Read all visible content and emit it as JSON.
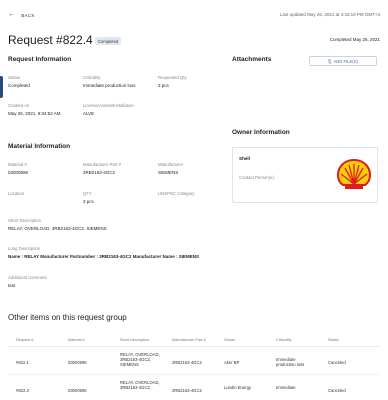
{
  "header": {
    "back_label": "BACK",
    "last_updated": "Last updated May 26, 2021 at 4:33:19 PM GMT+3"
  },
  "request": {
    "title": "Request #822.4",
    "status_badge": "Completed",
    "completed_date": "Completed May 26, 2021"
  },
  "request_information": {
    "section_title": "Request Information",
    "status_label": "Status",
    "status_value": "Completed",
    "criticality_label": "Criticality",
    "criticality_value": "Immediate production loss",
    "requested_qty_label": "Requested Qty",
    "requested_qty_value": "3 pcs",
    "created_on_label": "Created on",
    "created_on_value": "May 26, 2021, 9:34:52 AM",
    "license_label": "License/Assets/Installation",
    "license_value": "ALVE"
  },
  "attachments": {
    "section_title": "Attachments",
    "add_file_label": "ADD FILE(S)"
  },
  "owner_information": {
    "section_title": "Owner Information",
    "owner_name": "Shell",
    "contact_label": "Contact Person(s):"
  },
  "material_information": {
    "section_title": "Material Information",
    "material_label": "Material #",
    "material_value": "03000596",
    "mfr_part_label": "Manufacturer Part #",
    "mfr_part_value": "3RB2163-4GC2",
    "manufacturer_label": "Manufacturer",
    "manufacturer_value": "SIEMENS",
    "location_label": "Location",
    "qty_label": "QTY",
    "qty_value": "3 pcs",
    "unspsc_label": "UNSPSC Category",
    "short_desc_label": "Short Description",
    "short_desc_value": "RELAY, OVERLOAD, 3RB2163-4GC2, SIEMENS",
    "long_desc_label": "Long Description",
    "long_desc_value": "Name : RELAY  Manufacturer Partnumber : 3RB2163-4GC2  Manufacturer Name : SIEMENS",
    "comment_label": "Additional Comment",
    "comment_value": "test"
  },
  "other_items": {
    "section_title": "Other items on this request group",
    "columns": [
      "Request #",
      "Material #",
      "Short Description",
      "Manufacturer Part #",
      "Owner",
      "Criticality",
      "Status"
    ],
    "rows": [
      {
        "request": "#822.1",
        "material": "03000596",
        "description": "RELAY, OVERLOAD, 3RB2163-4GC2, SIEMENS",
        "part": "3RB2163-4GC2",
        "owner": "Aker BP",
        "criticality": "Immediate production loss",
        "status": "Canceled"
      },
      {
        "request": "#822.3",
        "material": "03000596",
        "description": "RELAY, OVERLOAD, 3RB2163-4GC2,",
        "part": "3RB2163-4GC2",
        "owner": "Lundin Energy",
        "criticality": "Immediate",
        "status": "Canceled"
      }
    ]
  },
  "colors": {
    "badge_bg": "#e2e8f0",
    "accent": "#4e6a9a",
    "shell_red": "#dd1d21",
    "shell_yellow": "#fbce07"
  }
}
